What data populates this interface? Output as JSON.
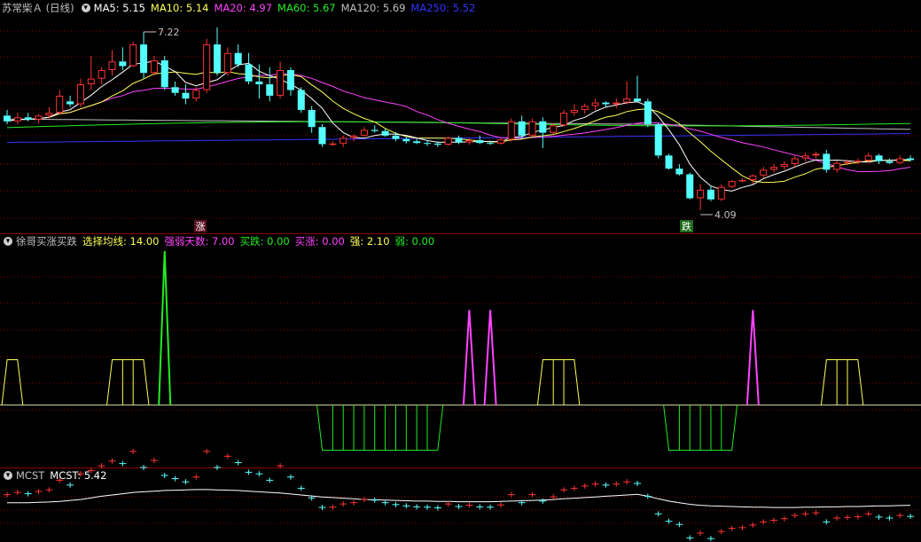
{
  "colors": {
    "up": "#ff3333",
    "down": "#54ffff",
    "grid": "#8b0000",
    "text": "#c0c0c0",
    "ma5": "#ffffff",
    "ma10": "#ffff55",
    "ma20": "#ff44ff",
    "ma60": "#22ee22",
    "ma120": "#c0c0c0",
    "ma250": "#3333ff"
  },
  "main_panel": {
    "title": "苏常柴Ａ (日线)",
    "ma5": {
      "label": "MA5: 5.15"
    },
    "ma10": {
      "label": "MA10: 5.14"
    },
    "ma20": {
      "label": "MA20: 4.97"
    },
    "ma60": {
      "label": "MA60: 5.67"
    },
    "ma120": {
      "label": "MA120: 5.69"
    },
    "ma250": {
      "label": "MA250: 5.52"
    },
    "high_label": "7.22",
    "low_label": "4.09",
    "signal_rise": "涨",
    "signal_fall": "跌"
  },
  "indicator_panel": {
    "title": "徐哥买涨买跌",
    "line_period": "选择均线: 14.00",
    "days": "强弱天数: 7.00",
    "buy_fall": "买跌: 0.00",
    "buy_rise": "买涨: 0.00",
    "strong": "强: 2.10",
    "weak": "弱: 0.00"
  },
  "mcst_panel": {
    "title": "MCST",
    "value": "MCST: 5.42"
  },
  "chart_data": [
    {
      "type": "candlestick",
      "title": "苏常柴Ａ (日线)",
      "y_range": [
        3.7,
        7.5
      ],
      "candles": [
        [
          5.75,
          5.85,
          5.6,
          5.65
        ],
        [
          5.65,
          5.8,
          5.6,
          5.72
        ],
        [
          5.72,
          5.8,
          5.65,
          5.68
        ],
        [
          5.68,
          5.78,
          5.62,
          5.75
        ],
        [
          5.75,
          5.9,
          5.7,
          5.8
        ],
        [
          5.8,
          6.2,
          5.78,
          6.1
        ],
        [
          6.0,
          6.1,
          5.9,
          5.95
        ],
        [
          5.95,
          6.4,
          5.9,
          6.3
        ],
        [
          6.3,
          6.8,
          6.2,
          6.4
        ],
        [
          6.4,
          6.6,
          6.3,
          6.55
        ],
        [
          6.55,
          6.9,
          6.45,
          6.7
        ],
        [
          6.7,
          6.95,
          6.55,
          6.62
        ],
        [
          6.62,
          7.05,
          6.6,
          7.0
        ],
        [
          7.0,
          7.22,
          6.4,
          6.5
        ],
        [
          6.5,
          6.8,
          6.45,
          6.72
        ],
        [
          6.72,
          6.8,
          6.2,
          6.25
        ],
        [
          6.25,
          6.35,
          6.1,
          6.15
        ],
        [
          6.15,
          6.3,
          5.95,
          6.05
        ],
        [
          6.05,
          6.25,
          6.0,
          6.2
        ],
        [
          6.2,
          7.1,
          6.15,
          7.0
        ],
        [
          7.0,
          7.3,
          6.45,
          6.5
        ],
        [
          6.5,
          6.95,
          6.45,
          6.85
        ],
        [
          6.85,
          7.0,
          6.6,
          6.65
        ],
        [
          6.65,
          6.85,
          6.3,
          6.35
        ],
        [
          6.35,
          6.65,
          6.05,
          6.3
        ],
        [
          6.3,
          6.6,
          6.0,
          6.1
        ],
        [
          6.1,
          6.7,
          6.05,
          6.55
        ],
        [
          6.55,
          6.6,
          6.1,
          6.2
        ],
        [
          6.2,
          6.25,
          5.8,
          5.85
        ],
        [
          5.85,
          5.92,
          5.45,
          5.55
        ],
        [
          5.55,
          5.6,
          5.2,
          5.25
        ],
        [
          5.25,
          5.3,
          5.22,
          5.26
        ],
        [
          5.26,
          5.4,
          5.2,
          5.36
        ],
        [
          5.36,
          5.42,
          5.3,
          5.4
        ],
        [
          5.4,
          5.55,
          5.38,
          5.5
        ],
        [
          5.5,
          5.58,
          5.45,
          5.48
        ],
        [
          5.48,
          5.52,
          5.38,
          5.4
        ],
        [
          5.4,
          5.46,
          5.3,
          5.34
        ],
        [
          5.34,
          5.38,
          5.26,
          5.3
        ],
        [
          5.3,
          5.34,
          5.25,
          5.27
        ],
        [
          5.27,
          5.32,
          5.22,
          5.26
        ],
        [
          5.26,
          5.3,
          5.2,
          5.24
        ],
        [
          5.24,
          5.38,
          5.22,
          5.36
        ],
        [
          5.36,
          5.4,
          5.25,
          5.28
        ],
        [
          5.28,
          5.35,
          5.24,
          5.32
        ],
        [
          5.32,
          5.4,
          5.25,
          5.27
        ],
        [
          5.27,
          5.3,
          5.24,
          5.26
        ],
        [
          5.26,
          5.35,
          5.24,
          5.33
        ],
        [
          5.33,
          5.7,
          5.3,
          5.65
        ],
        [
          5.65,
          5.75,
          5.35,
          5.4
        ],
        [
          5.4,
          5.7,
          5.38,
          5.65
        ],
        [
          5.65,
          5.72,
          5.18,
          5.45
        ],
        [
          5.45,
          5.62,
          5.42,
          5.58
        ],
        [
          5.58,
          5.85,
          5.56,
          5.8
        ],
        [
          5.8,
          5.95,
          5.75,
          5.85
        ],
        [
          5.85,
          5.96,
          5.78,
          5.92
        ],
        [
          5.92,
          6.05,
          5.85,
          5.98
        ],
        [
          5.98,
          6.0,
          5.9,
          5.95
        ],
        [
          5.95,
          6.05,
          5.88,
          5.98
        ],
        [
          5.98,
          6.35,
          5.95,
          6.05
        ],
        [
          6.05,
          6.45,
          6.0,
          6.0
        ],
        [
          6.0,
          6.05,
          5.55,
          5.6
        ],
        [
          5.6,
          5.62,
          5.0,
          5.05
        ],
        [
          5.05,
          5.08,
          4.8,
          4.82
        ],
        [
          4.82,
          4.9,
          4.7,
          4.72
        ],
        [
          4.72,
          4.75,
          4.28,
          4.3
        ],
        [
          4.3,
          4.55,
          4.09,
          4.45
        ],
        [
          4.45,
          4.52,
          4.25,
          4.28
        ],
        [
          4.28,
          4.55,
          4.25,
          4.5
        ],
        [
          4.5,
          4.62,
          4.48,
          4.6
        ],
        [
          4.6,
          4.65,
          4.58,
          4.62
        ],
        [
          4.62,
          4.72,
          4.55,
          4.7
        ],
        [
          4.7,
          4.85,
          4.65,
          4.8
        ],
        [
          4.8,
          4.9,
          4.75,
          4.85
        ],
        [
          4.85,
          4.95,
          4.8,
          4.9
        ],
        [
          4.9,
          5.05,
          4.85,
          5.0
        ],
        [
          5.0,
          5.1,
          4.95,
          5.05
        ],
        [
          5.05,
          5.12,
          5.0,
          5.08
        ],
        [
          5.08,
          5.15,
          4.75,
          4.8
        ],
        [
          4.8,
          4.95,
          4.75,
          4.92
        ],
        [
          4.92,
          4.98,
          4.88,
          4.94
        ],
        [
          4.94,
          5.0,
          4.9,
          4.96
        ],
        [
          4.96,
          5.1,
          4.92,
          5.05
        ],
        [
          5.05,
          5.08,
          4.9,
          4.95
        ],
        [
          4.95,
          5.0,
          4.9,
          4.92
        ],
        [
          4.92,
          5.05,
          4.9,
          5.0
        ],
        [
          5.0,
          5.05,
          4.95,
          4.97
        ]
      ]
    },
    {
      "type": "line",
      "title": "徐哥买涨买跌",
      "y_range": [
        -1.3,
        3.4
      ],
      "series": [
        {
          "name": "强弱",
          "values": [
            1,
            1,
            0,
            0,
            0,
            0,
            0,
            0,
            0,
            0,
            1,
            1,
            1,
            1,
            0,
            3.4,
            0,
            0,
            0,
            0,
            0,
            0,
            0,
            0,
            0,
            0,
            0,
            0,
            0,
            0,
            -1,
            -1,
            -1,
            -1,
            -1,
            -1,
            -1,
            -1,
            -1,
            -1,
            -1,
            -1,
            0,
            0,
            2.1,
            0,
            2.1,
            0,
            0,
            0,
            0,
            1,
            1,
            1,
            1,
            0,
            0,
            0,
            0,
            0,
            0,
            0,
            0,
            -1,
            -1,
            -1,
            -1,
            -1,
            -1,
            -1,
            0,
            2.1,
            0,
            0,
            0,
            0,
            0,
            0,
            1,
            1,
            1,
            1
          ]
        }
      ]
    },
    {
      "type": "line",
      "title": "MCST",
      "y_range": [
        4.2,
        6.0
      ],
      "series": [
        {
          "name": "MCST",
          "values": [
            5.4,
            5.4,
            5.4,
            5.41,
            5.42,
            5.44,
            5.47,
            5.5,
            5.55,
            5.6,
            5.64,
            5.68,
            5.72,
            5.74,
            5.76,
            5.78,
            5.79,
            5.8,
            5.81,
            5.81,
            5.8,
            5.79,
            5.78,
            5.76,
            5.74,
            5.72,
            5.7,
            5.67,
            5.64,
            5.61,
            5.58,
            5.56,
            5.54,
            5.52,
            5.5,
            5.49,
            5.48,
            5.47,
            5.46,
            5.45,
            5.45,
            5.44,
            5.44,
            5.43,
            5.43,
            5.43,
            5.43,
            5.44,
            5.45,
            5.46,
            5.47,
            5.48,
            5.5,
            5.52,
            5.54,
            5.56,
            5.58,
            5.6,
            5.62,
            5.64,
            5.66,
            5.6,
            5.52,
            5.45,
            5.4,
            5.35,
            5.32,
            5.3,
            5.29,
            5.28,
            5.27,
            5.26,
            5.26,
            5.25,
            5.25,
            5.25,
            5.26,
            5.26,
            5.27,
            5.27,
            5.28,
            5.28,
            5.29,
            5.3,
            5.3,
            5.31,
            5.32
          ]
        }
      ],
      "close": [
        5.65,
        5.72,
        5.68,
        5.75,
        5.8,
        6.1,
        5.95,
        6.3,
        6.4,
        6.55,
        6.7,
        6.62,
        7.0,
        6.5,
        6.72,
        6.25,
        6.15,
        6.05,
        6.2,
        7.0,
        6.5,
        6.85,
        6.65,
        6.35,
        6.3,
        6.1,
        6.55,
        6.2,
        5.85,
        5.55,
        5.25,
        5.26,
        5.36,
        5.4,
        5.5,
        5.48,
        5.4,
        5.34,
        5.3,
        5.27,
        5.26,
        5.24,
        5.36,
        5.28,
        5.32,
        5.27,
        5.26,
        5.33,
        5.65,
        5.4,
        5.65,
        5.45,
        5.58,
        5.8,
        5.85,
        5.92,
        5.98,
        5.95,
        5.98,
        6.05,
        6.0,
        5.6,
        5.05,
        4.82,
        4.72,
        4.3,
        4.45,
        4.28,
        4.5,
        4.6,
        4.62,
        4.7,
        4.8,
        4.85,
        4.9,
        5.0,
        5.05,
        5.08,
        4.8,
        4.92,
        4.94,
        4.96,
        5.05,
        4.95,
        4.92,
        5.0,
        4.97
      ]
    }
  ]
}
